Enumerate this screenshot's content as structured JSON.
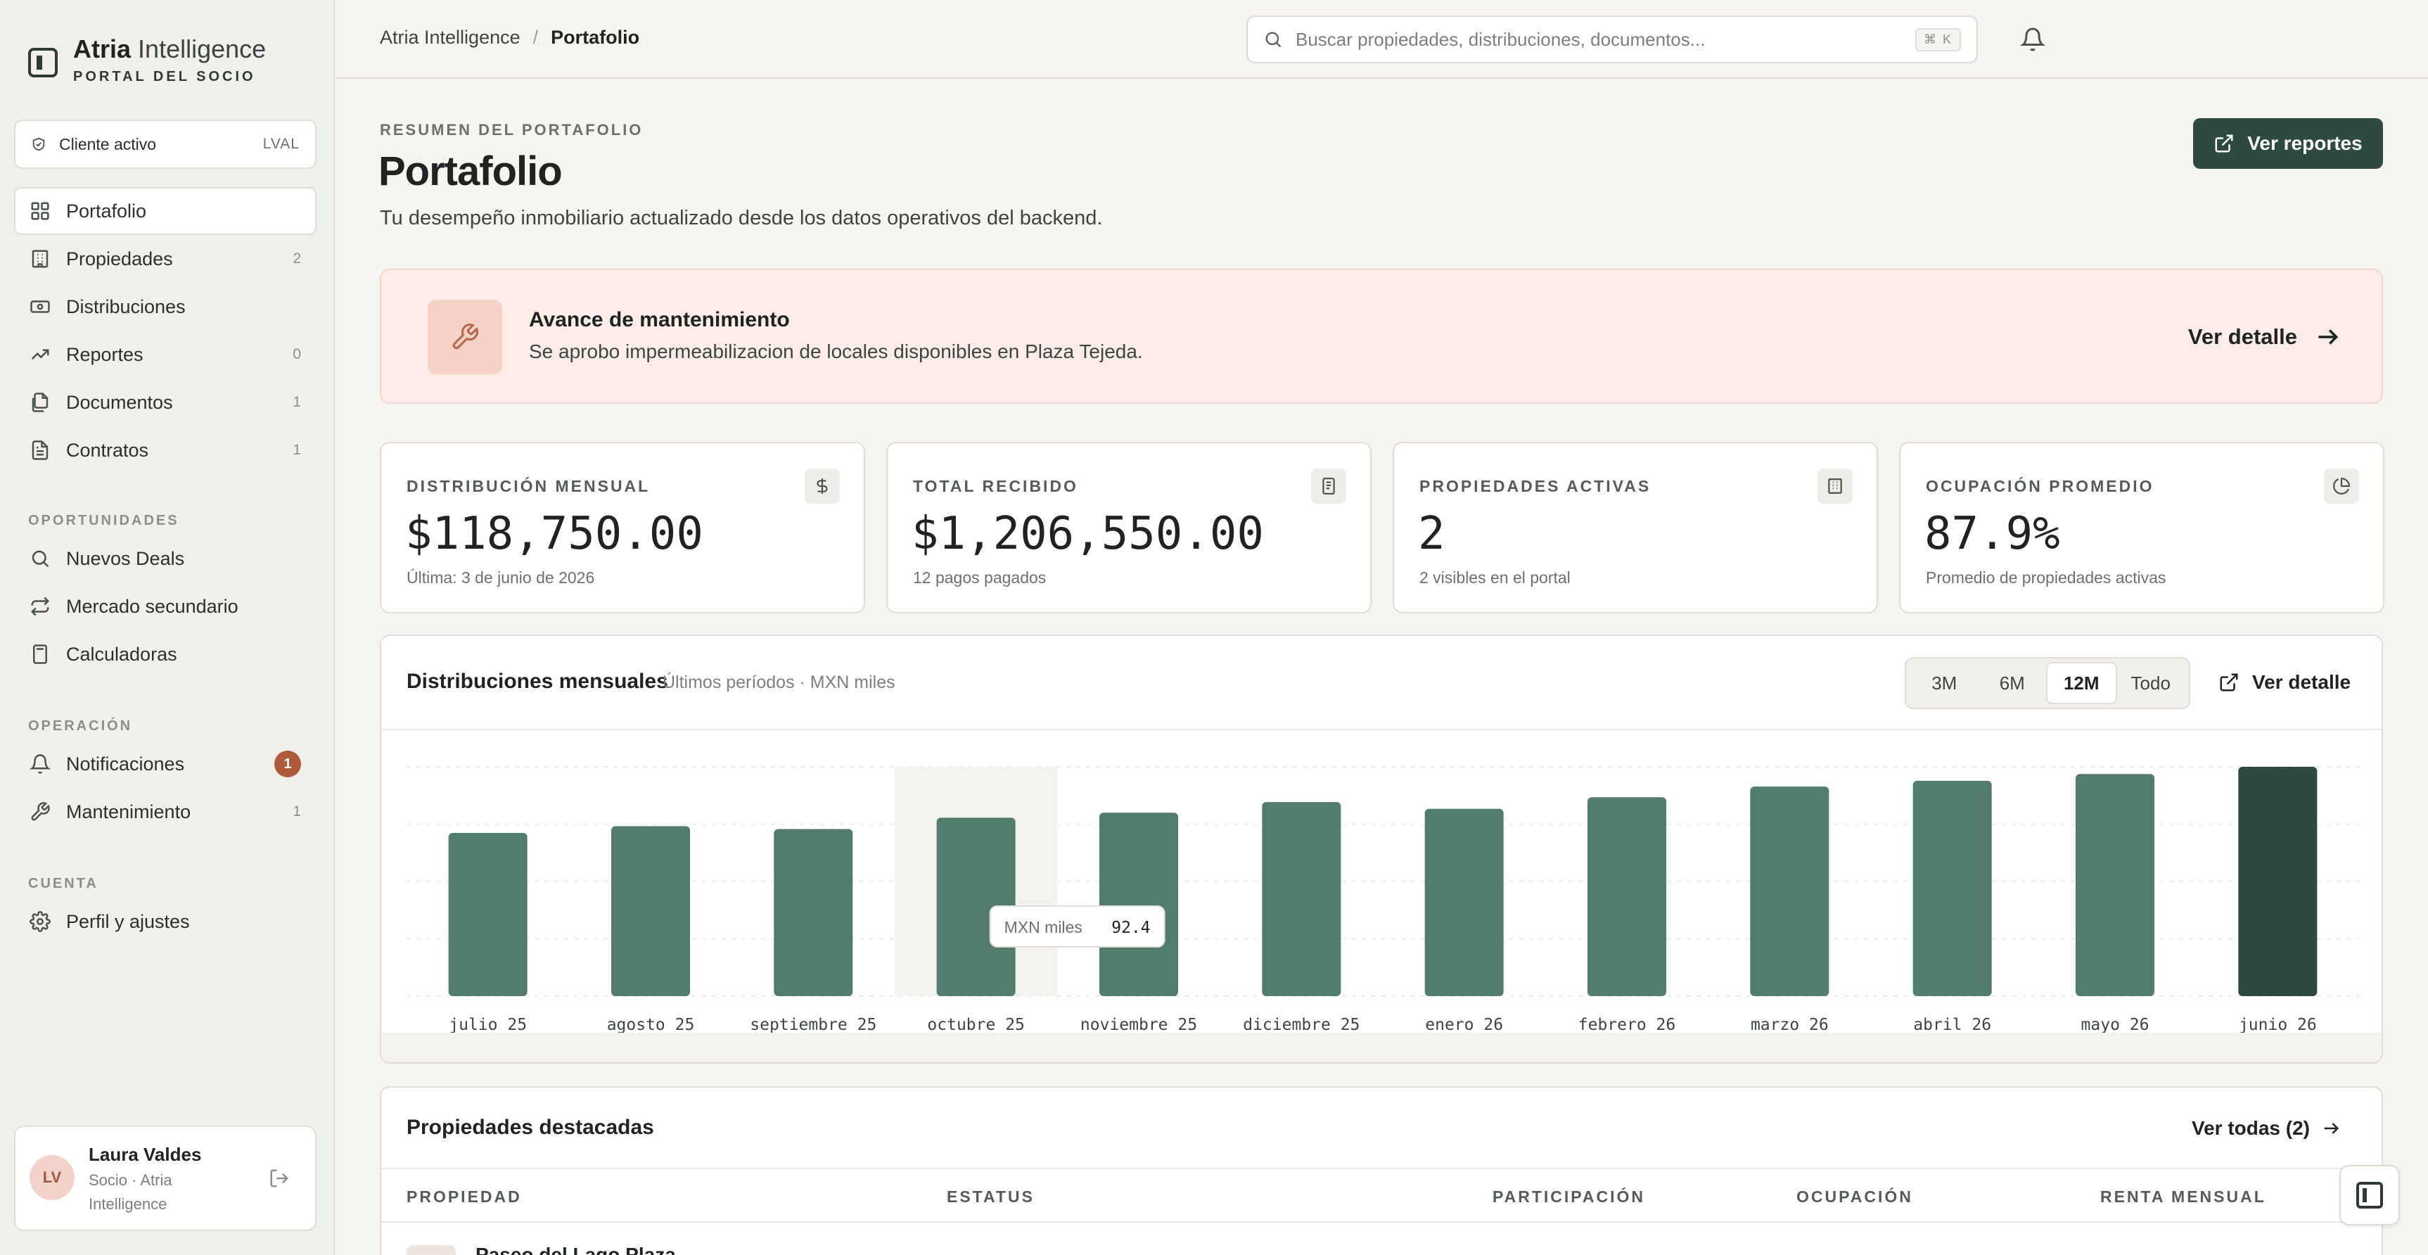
{
  "brand": {
    "name_bold": "Atria",
    "name_light": "Intelligence",
    "subtitle": "PORTAL DEL SOCIO"
  },
  "client": {
    "label": "Cliente activo",
    "code": "LVAL"
  },
  "sidebar": {
    "main_items": [
      {
        "label": "Portafolio",
        "count": "",
        "icon": "grid-icon"
      },
      {
        "label": "Propiedades",
        "count": "2",
        "icon": "building-icon"
      },
      {
        "label": "Distribuciones",
        "count": "",
        "icon": "banknote-icon"
      },
      {
        "label": "Reportes",
        "count": "0",
        "icon": "trending-up-icon"
      },
      {
        "label": "Documentos",
        "count": "1",
        "icon": "files-icon"
      },
      {
        "label": "Contratos",
        "count": "1",
        "icon": "document-icon"
      }
    ],
    "section_opportunities": "OPORTUNIDADES",
    "opportunity_items": [
      {
        "label": "Nuevos Deals",
        "icon": "search-icon"
      },
      {
        "label": "Mercado secundario",
        "icon": "repeat-icon"
      },
      {
        "label": "Calculadoras",
        "icon": "calculator-icon"
      }
    ],
    "section_operation": "OPERACIÓN",
    "operation_items": [
      {
        "label": "Notificaciones",
        "badge": "1",
        "icon": "bell-icon"
      },
      {
        "label": "Mantenimiento",
        "count": "1",
        "icon": "wrench-icon"
      }
    ],
    "section_account": "CUENTA",
    "account_items": [
      {
        "label": "Perfil y ajustes",
        "icon": "gear-icon"
      }
    ]
  },
  "user": {
    "initials": "LV",
    "name": "Laura Valdes",
    "role": "Socio · Atria Intelligence"
  },
  "topbar": {
    "breadcrumb_root": "Atria Intelligence",
    "breadcrumb_sep": "/",
    "breadcrumb_current": "Portafolio",
    "search_placeholder": "Buscar propiedades, distribuciones, documentos...",
    "search_shortcut": "⌘ K"
  },
  "header": {
    "eyebrow": "RESUMEN DEL PORTAFOLIO",
    "title": "Portafolio",
    "description": "Tu desempeño inmobiliario actualizado desde los datos operativos del backend.",
    "report_button": "Ver reportes"
  },
  "alert": {
    "title": "Avance de mantenimiento",
    "text": "Se aprobo impermeabilizacion de locales disponibles en Plaza Tejeda.",
    "link": "Ver detalle"
  },
  "kpis": [
    {
      "label": "DISTRIBUCIÓN MENSUAL",
      "value": "$118,750.00",
      "sub": "Última: 3 de junio de 2026",
      "icon": "dollar-icon"
    },
    {
      "label": "TOTAL RECIBIDO",
      "value": "$1,206,550.00",
      "sub": "12 pagos pagados",
      "icon": "receipt-icon"
    },
    {
      "label": "PROPIEDADES ACTIVAS",
      "value": "2",
      "sub": "2 visibles en el portal",
      "icon": "building-icon"
    },
    {
      "label": "OCUPACIÓN PROMEDIO",
      "value": "87.9%",
      "sub": "Promedio de propiedades activas",
      "icon": "pie-chart-icon"
    }
  ],
  "chart_card": {
    "title": "Distribuciones mensuales",
    "subtitle": "Últimos períodos · MXN miles",
    "ranges": [
      "3M",
      "6M",
      "12M",
      "Todo"
    ],
    "active_range": "12M",
    "link": "Ver detalle",
    "tooltip_label": "MXN miles",
    "tooltip_value": "92.4"
  },
  "chart_data": {
    "type": "bar",
    "categories": [
      "julio 25",
      "agosto 25",
      "septiembre 25",
      "octubre 25",
      "noviembre 25",
      "diciembre 25",
      "enero 26",
      "febrero 26",
      "marzo 26",
      "abril 26",
      "mayo 26",
      "junio 26"
    ],
    "series": [
      {
        "name": "MXN miles",
        "values": [
          84.5,
          88.0,
          86.5,
          92.4,
          95.0,
          100.5,
          97.0,
          103.0,
          108.5,
          111.5,
          115.0,
          118.75
        ]
      }
    ],
    "ylim": [
      0,
      118.75
    ],
    "grid": true,
    "highlighted_category": "octubre 25",
    "colors": {
      "bar": "#527d6c",
      "last_bar": "#2f4a3f",
      "highlight_bg": "#f3f2ef"
    }
  },
  "properties": {
    "title": "Propiedades destacadas",
    "link": "Ver todas (2)",
    "columns": [
      "PROPIEDAD",
      "ESTATUS",
      "PARTICIPACIÓN",
      "OCUPACIÓN",
      "RENTA MENSUAL"
    ],
    "first_row_name": "Paseo del Lago Plaza"
  }
}
